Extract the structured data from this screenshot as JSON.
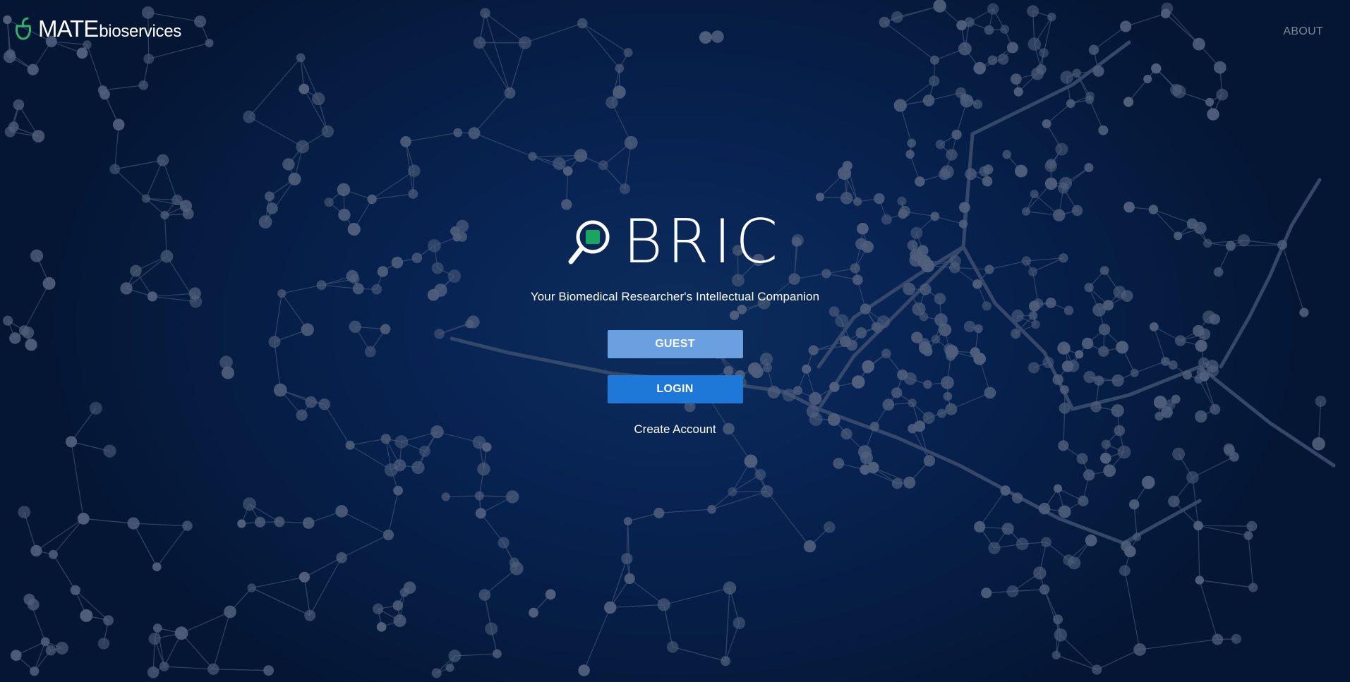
{
  "header": {
    "brand_main": "MATE",
    "brand_sub": "bioservices",
    "nav_about": "ABOUT"
  },
  "hero": {
    "logo_text": "BRIC",
    "tagline": "Your Biomedical Researcher's Intellectual Companion",
    "guest_label": "GUEST",
    "login_label": "LOGIN",
    "create_account_label": "Create Account"
  },
  "colors": {
    "background": "#061a3a",
    "guest_button": "#6aa0e0",
    "login_button": "#1e78d8",
    "brand_green": "#2fb36a",
    "network_node": "#56657f"
  },
  "icons": {
    "brand_logo": "mate-leaf-icon",
    "bric_logo": "magnifier-icon"
  }
}
